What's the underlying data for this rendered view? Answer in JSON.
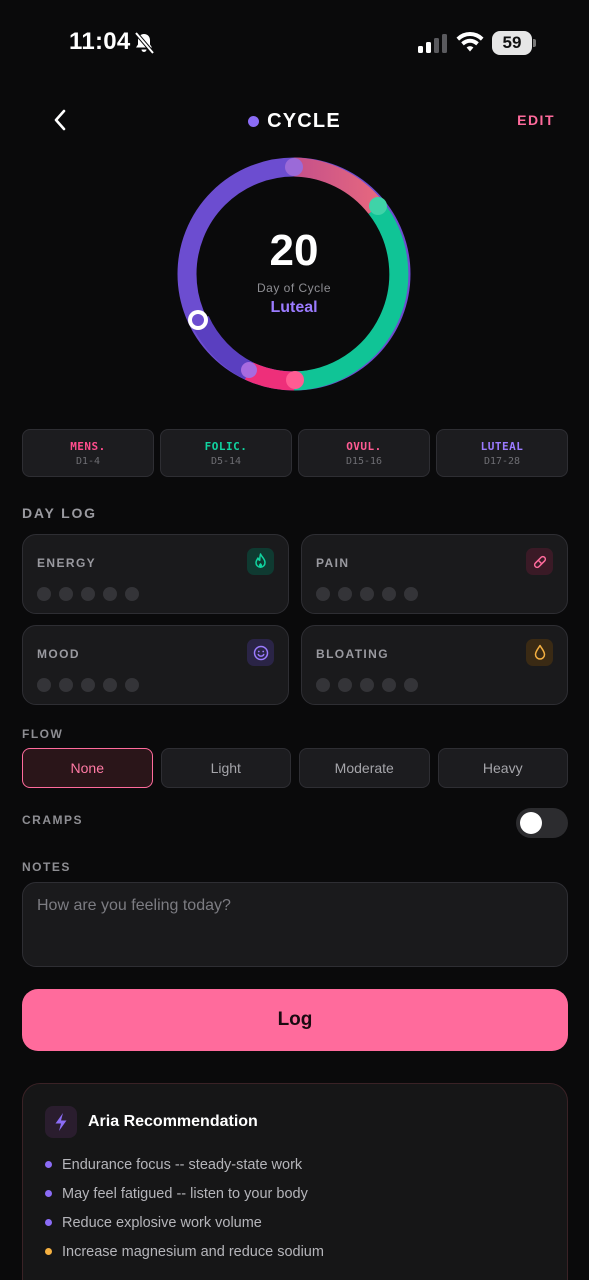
{
  "status_bar": {
    "time": "11:04",
    "battery": "59",
    "icons": [
      "bell-slash-icon",
      "signal-icon",
      "wifi-icon",
      "battery-icon"
    ]
  },
  "header": {
    "title": "CYCLE",
    "edit_label": "EDIT",
    "dot_color": "#8b6cf6"
  },
  "cycle": {
    "day": "20",
    "caption": "Day of Cycle",
    "phase": "Luteal",
    "phase_color": "#9b7bff",
    "total_days": 28
  },
  "phases": [
    {
      "label": "MENS.",
      "range": "D1-4",
      "color": "#ff4d8d"
    },
    {
      "label": "FOLIC.",
      "range": "D5-14",
      "color": "#10d4a0"
    },
    {
      "label": "OVUL.",
      "range": "D15-16",
      "color": "#ff5b93"
    },
    {
      "label": "LUTEAL",
      "range": "D17-28",
      "color": "#8b6cf6"
    }
  ],
  "day_log": {
    "title": "DAY LOG",
    "cards": [
      {
        "label": "ENERGY",
        "icon": "flame-icon",
        "icon_color": "#10d4a0",
        "icon_bg": "#0f3a31",
        "rating": 0,
        "max": 5
      },
      {
        "label": "PAIN",
        "icon": "pill-icon",
        "icon_color": "#ff6b9c",
        "icon_bg": "#3a1a26",
        "rating": 0,
        "max": 5
      },
      {
        "label": "MOOD",
        "icon": "smile-icon",
        "icon_color": "#9b7bff",
        "icon_bg": "#2a2446",
        "rating": 0,
        "max": 5
      },
      {
        "label": "BLOATING",
        "icon": "droplet-icon",
        "icon_color": "#f5b041",
        "icon_bg": "#3a2a14",
        "rating": 0,
        "max": 5
      }
    ]
  },
  "flow": {
    "title": "FLOW",
    "options": [
      "None",
      "Light",
      "Moderate",
      "Heavy"
    ],
    "selected": "None"
  },
  "cramps": {
    "title": "CRAMPS",
    "enabled": false
  },
  "notes": {
    "title": "NOTES",
    "placeholder": "How are you feeling today?",
    "value": ""
  },
  "log_button": "Log",
  "recommendation": {
    "title": "Aria Recommendation",
    "icon": "bolt-icon",
    "items": [
      {
        "text": "Endurance focus -- steady-state work",
        "color": "#8b6cf6"
      },
      {
        "text": "May feel fatigued -- listen to your body",
        "color": "#8b6cf6"
      },
      {
        "text": "Reduce explosive work volume",
        "color": "#8b6cf6"
      },
      {
        "text": "Increase magnesium and reduce sodium",
        "color": "#f5b041"
      }
    ]
  }
}
